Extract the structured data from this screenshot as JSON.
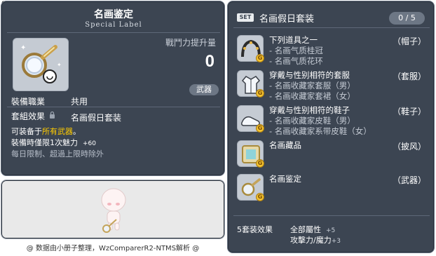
{
  "id_label": "01703361",
  "item": {
    "title": "名画鉴定",
    "subtitle": "Special Label",
    "stat_label": "戰鬥力提升量",
    "stat_value": "0",
    "category_badge": "武器",
    "job_label": "裝備職業",
    "job_value": "共用",
    "set_label": "套組效果",
    "set_value": "名画假日套装",
    "desc1_pre": "可装备于",
    "desc1_hl": "所有武器",
    "desc1_post": "。",
    "desc2": "裝備時僅限1次魅力",
    "desc2_val": "+60",
    "desc3": "每日限制、超過上限時除外"
  },
  "footer": "@ 数据由小册子整理，WzComparerR2-NTMS解析 @",
  "set": {
    "badge": "SET",
    "title": "名画假日套装",
    "count": "0 / 5",
    "items": [
      {
        "lines": [
          "下列道具之一",
          "- 名画气质桂冠",
          "- 名画气质花环"
        ],
        "type": "（帽子）",
        "icon": "wreath-icon"
      },
      {
        "lines": [
          "穿戴与性别相符的套服",
          "- 名画收藏家套服（男）",
          "- 名画收藏家套裙（女）"
        ],
        "type": "（套服）",
        "icon": "outfit-icon"
      },
      {
        "lines": [
          "穿戴与性别相符的鞋子",
          "- 名画收藏家皮鞋（男）",
          "- 名画收藏家系带皮鞋（女）"
        ],
        "type": "（鞋子）",
        "icon": "shoe-icon"
      },
      {
        "lines": [
          "名画藏品"
        ],
        "type": "（披风）",
        "icon": "frame-icon"
      },
      {
        "lines": [
          "名画鉴定"
        ],
        "type": "（武器）",
        "icon": "magnifier-icon"
      }
    ],
    "effect_label": "5套装效果",
    "effect1": "全部屬性",
    "effect1_val": "+5",
    "effect2": "攻擊力/魔力",
    "effect2_val": "+3"
  },
  "colors": {
    "panel": "#3c4552",
    "highlight": "#ffcc00",
    "coin": "#f2c230"
  }
}
